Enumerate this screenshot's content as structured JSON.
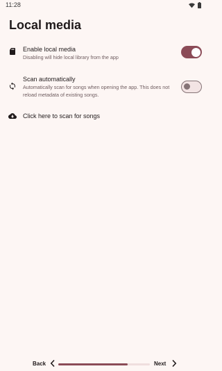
{
  "status_bar": {
    "time": "11:28",
    "icons": [
      "wifi-icon",
      "battery-icon"
    ]
  },
  "page": {
    "title": "Local media"
  },
  "settings": [
    {
      "icon": "sd-card-icon",
      "title": "Enable local media",
      "subtitle": "Disabling will hide local library from the app",
      "toggle": true
    },
    {
      "icon": "sync-icon",
      "title": "Scan automatically",
      "subtitle": "Automatically scan for songs when opening the app. This does not reload metadata of existing songs.",
      "toggle": false
    },
    {
      "icon": "cloud-download-icon",
      "title": "Click here to scan for songs"
    }
  ],
  "navigation": {
    "back_label": "Back",
    "next_label": "Next",
    "progress": 0.76
  },
  "colors": {
    "accent": "#8b4b57",
    "background": "#fdf6f4"
  }
}
